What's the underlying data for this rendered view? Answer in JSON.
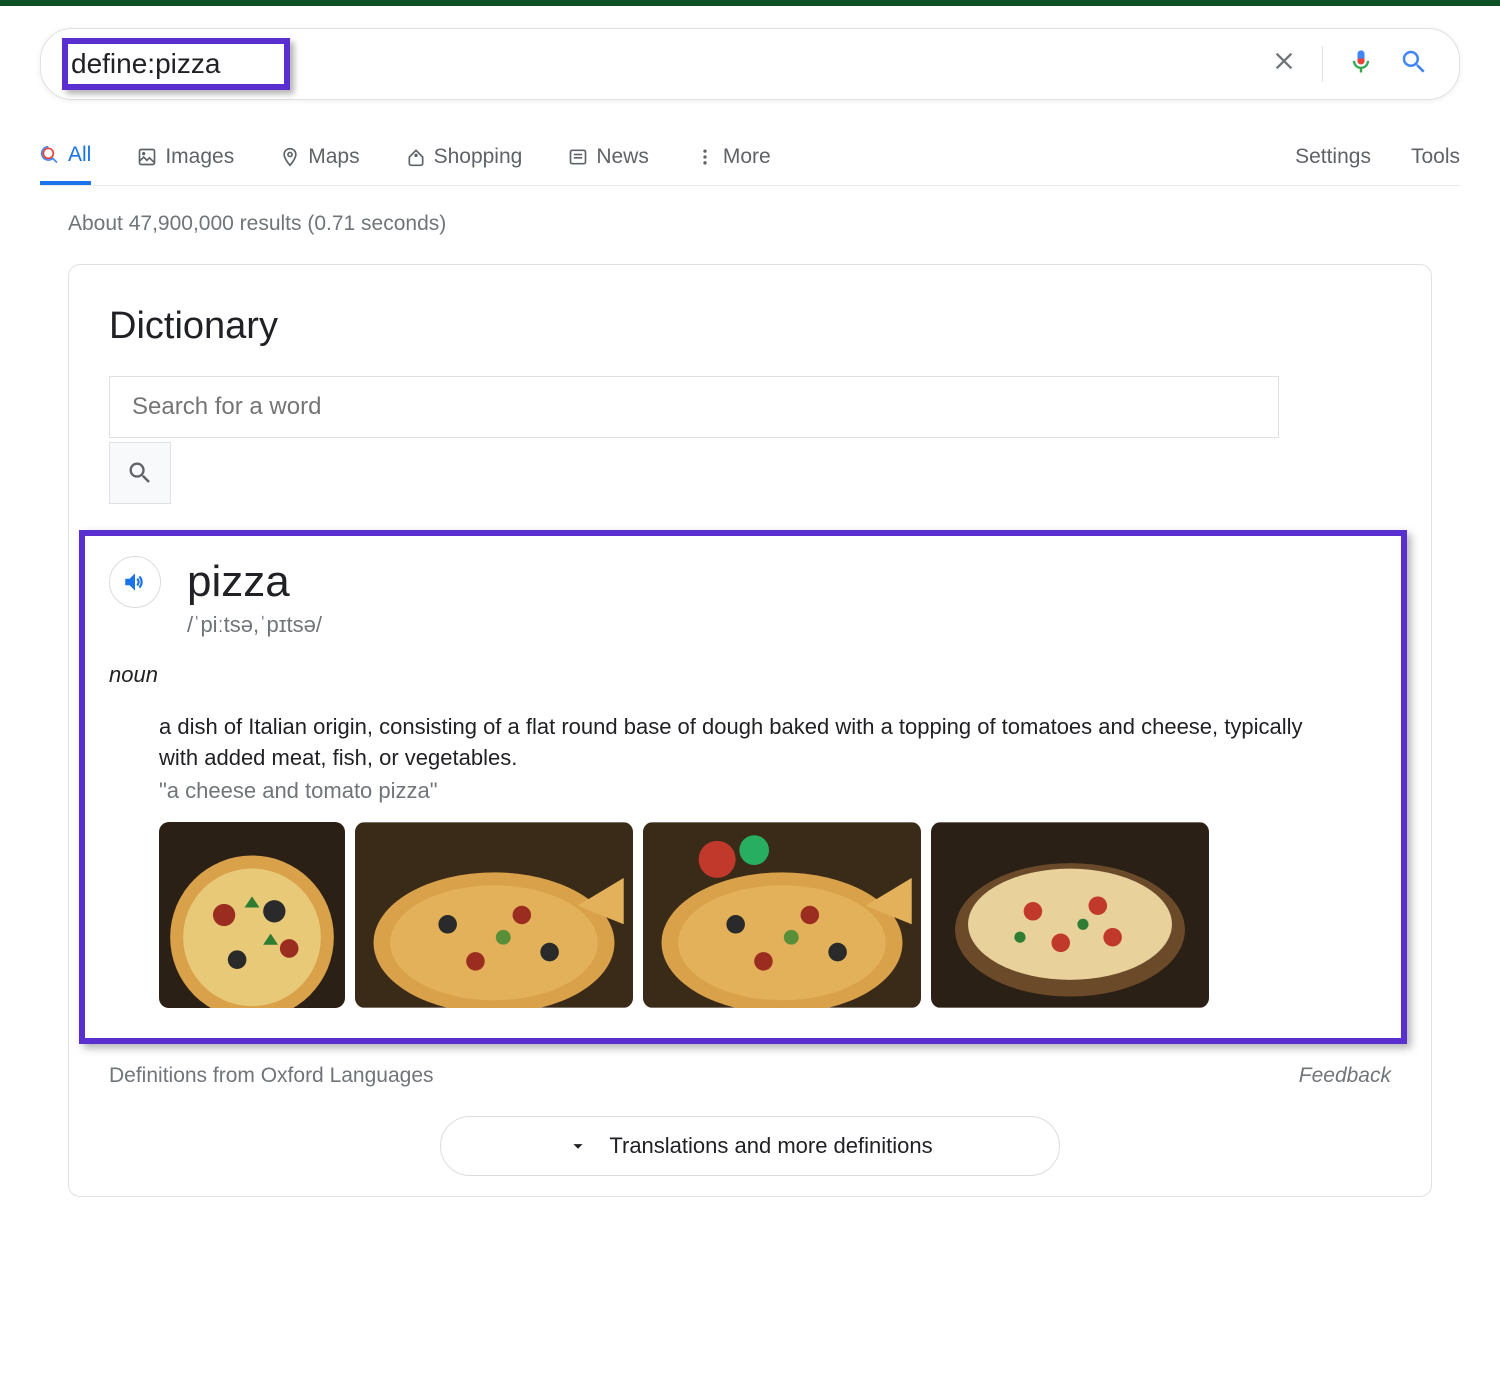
{
  "search": {
    "query": "define:pizza",
    "clearLabel": "Clear",
    "voiceLabel": "Voice search",
    "searchLabel": "Search"
  },
  "tabs": {
    "all": "All",
    "images": "Images",
    "maps": "Maps",
    "shopping": "Shopping",
    "news": "News",
    "more": "More",
    "settings": "Settings",
    "tools": "Tools"
  },
  "resultsCount": "About 47,900,000 results (0.71 seconds)",
  "dictionary": {
    "title": "Dictionary",
    "searchPlaceholder": "Search for a word",
    "word": "pizza",
    "phonetic": "/ˈpiːtsə,ˈpɪtsə/",
    "pos": "noun",
    "definition": "a dish of Italian origin, consisting of a flat round base of dough baked with a topping of tomatoes and cheese, typically with added meat, fish, or vegetables.",
    "example": "\"a cheese and tomato pizza\"",
    "attribution": "Definitions from Oxford Languages",
    "feedback": "Feedback",
    "translationsBtn": "Translations and more definitions"
  }
}
